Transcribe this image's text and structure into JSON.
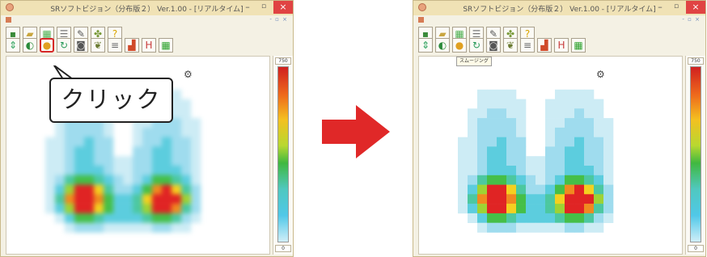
{
  "app": {
    "title": "SRソフトビジョン（分布版２）  Ver.1.00 - [リアルタイム]",
    "mdi_controls": "- ▫ ×",
    "min_glyph": "–",
    "max_glyph": "▫",
    "close_glyph": "×"
  },
  "toolbar1": [
    {
      "name": "file-icon",
      "glyph": "▪",
      "color": "#3a8a3a"
    },
    {
      "name": "folder-open-icon",
      "glyph": "▰",
      "color": "#c9a640"
    },
    {
      "name": "grid-icon",
      "glyph": "▦",
      "color": "#4caf50"
    },
    {
      "name": "list-icon",
      "glyph": "☰",
      "color": "#777777"
    },
    {
      "name": "wrench-icon",
      "glyph": "✎",
      "color": "#555555"
    },
    {
      "name": "puzzle-icon",
      "glyph": "✤",
      "color": "#7a9a3a"
    },
    {
      "name": "help-icon",
      "glyph": "?",
      "color": "#d9a400"
    }
  ],
  "toolbar2": [
    {
      "name": "up-down-icon",
      "glyph": "⇕",
      "color": "#2aa15a"
    },
    {
      "name": "rotate-icon",
      "glyph": "◐",
      "color": "#2a8a3a"
    },
    {
      "name": "smoothing-icon",
      "glyph": "●",
      "color": "#e0a020"
    },
    {
      "name": "refresh-icon",
      "glyph": "↻",
      "color": "#2a9a5a"
    },
    {
      "name": "camera-icon",
      "glyph": "◙",
      "color": "#555555"
    },
    {
      "name": "footprint-icon",
      "glyph": "❦",
      "color": "#6a7a30"
    },
    {
      "name": "bars-icon",
      "glyph": "≡",
      "color": "#666666"
    },
    {
      "name": "bar-chart-icon",
      "glyph": "▟",
      "color": "#d04a2a"
    },
    {
      "name": "h-icon",
      "glyph": "H",
      "color": "#c83a3a"
    },
    {
      "name": "green-grid-icon",
      "glyph": "▦",
      "color": "#2aa02a"
    }
  ],
  "callout": {
    "text": "クリック"
  },
  "tooltip": {
    "text": "スムージング"
  },
  "sidebar": {
    "top_value": "750",
    "bottom_value": "0"
  },
  "colors": {
    "highlight": "#d62727",
    "arrow": "#e02828",
    "window_border": "#c9b98a",
    "close_button": "#e04343"
  }
}
